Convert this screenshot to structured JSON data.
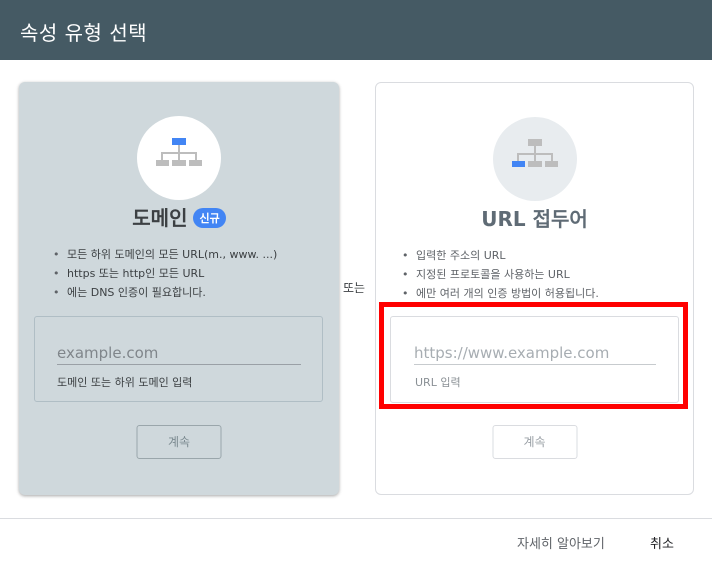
{
  "dialog": {
    "title": "속성 유형 선택"
  },
  "domain_card": {
    "title": "도메인",
    "badge": "신규",
    "bullets": [
      "모든 하위 도메인의 모든 URL(m., www. ...)",
      "https 또는 http인 모든 URL",
      "에는 DNS 인증이 필요합니다."
    ],
    "input_placeholder": "example.com",
    "input_hint": "도메인 또는 하위 도메인 입력",
    "continue_label": "계속",
    "icon": "sitemap-icon",
    "icon_accent": "#4285f4"
  },
  "separator": "또는",
  "url_card": {
    "title": "URL 접두어",
    "bullets": [
      "입력한 주소의 URL",
      "지정된 프로토콜을 사용하는 URL",
      "에만 여러 개의 인증 방법이 허용됩니다."
    ],
    "input_placeholder": "https://www.example.com",
    "input_hint": "URL 입력",
    "continue_label": "계속",
    "icon": "sitemap-icon",
    "icon_accent": "#4285f4"
  },
  "footer": {
    "learn_more": "자세히 알아보기",
    "cancel": "취소"
  },
  "colors": {
    "header_bg": "#455a64",
    "highlight": "#ff0000",
    "domain_card_bg": "#cfd8dc"
  }
}
